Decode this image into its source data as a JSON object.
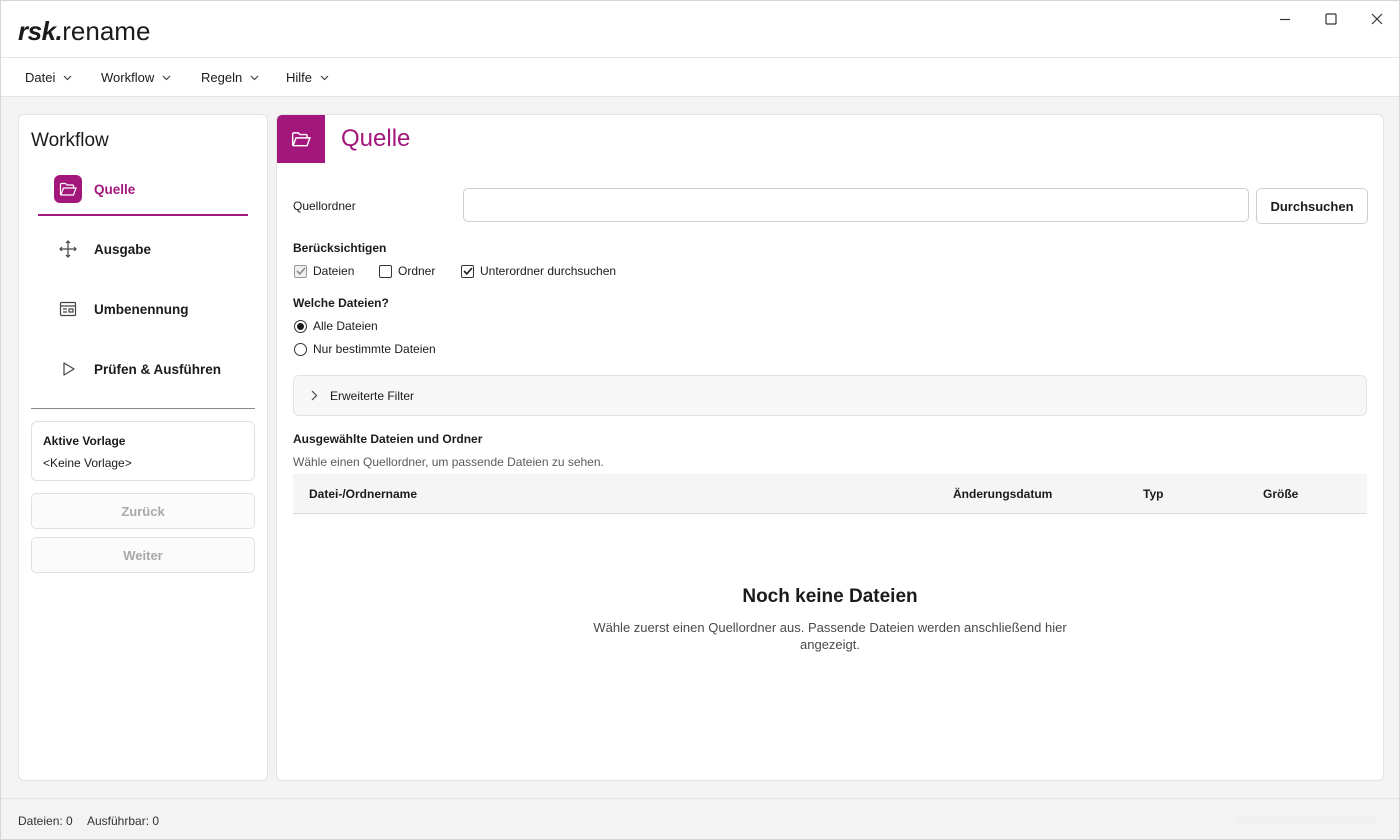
{
  "app": {
    "logo_bold": "rsk.",
    "logo_rest": "rename"
  },
  "menu": {
    "items": [
      "Datei",
      "Workflow",
      "Regeln",
      "Hilfe"
    ]
  },
  "sidebar": {
    "title": "Workflow",
    "steps": [
      {
        "label": "Quelle",
        "icon": "folder-open-icon",
        "active": true
      },
      {
        "label": "Ausgabe",
        "icon": "move-arrows-icon",
        "active": false
      },
      {
        "label": "Umbenennung",
        "icon": "template-icon",
        "active": false
      },
      {
        "label": "Prüfen & Ausführen",
        "icon": "play-icon",
        "active": false
      }
    ],
    "template_title": "Aktive Vorlage",
    "template_value": "<Keine Vorlage>",
    "back_label": "Zurück",
    "next_label": "Weiter"
  },
  "main": {
    "title": "Quelle",
    "source_folder_label": "Quellordner",
    "source_folder_value": "",
    "browse_label": "Durchsuchen",
    "consider_label": "Berücksichtigen",
    "consider_options": [
      {
        "label": "Dateien",
        "checked": true,
        "disabled": true
      },
      {
        "label": "Ordner",
        "checked": false,
        "disabled": false
      },
      {
        "label": "Unterordner durchsuchen",
        "checked": true,
        "disabled": false
      }
    ],
    "which_files_label": "Welche Dateien?",
    "which_files_options": [
      {
        "label": "Alle Dateien",
        "selected": true
      },
      {
        "label": "Nur bestimmte Dateien",
        "selected": false
      }
    ],
    "advanced_filter_label": "Erweiterte Filter",
    "selected_title": "Ausgewählte Dateien und Ordner",
    "selected_hint": "Wähle einen Quellordner, um passende Dateien zu sehen.",
    "columns": [
      "Datei-/Ordnername",
      "Änderungsdatum",
      "Typ",
      "Größe"
    ],
    "rows": [],
    "empty_title": "Noch keine Dateien",
    "empty_text": "Wähle zuerst einen Quellordner aus. Passende Dateien werden anschließend hier angezeigt."
  },
  "status": {
    "files": "Dateien: 0",
    "executable": "Ausführbar: 0"
  },
  "colors": {
    "accent": "#a3177c"
  }
}
